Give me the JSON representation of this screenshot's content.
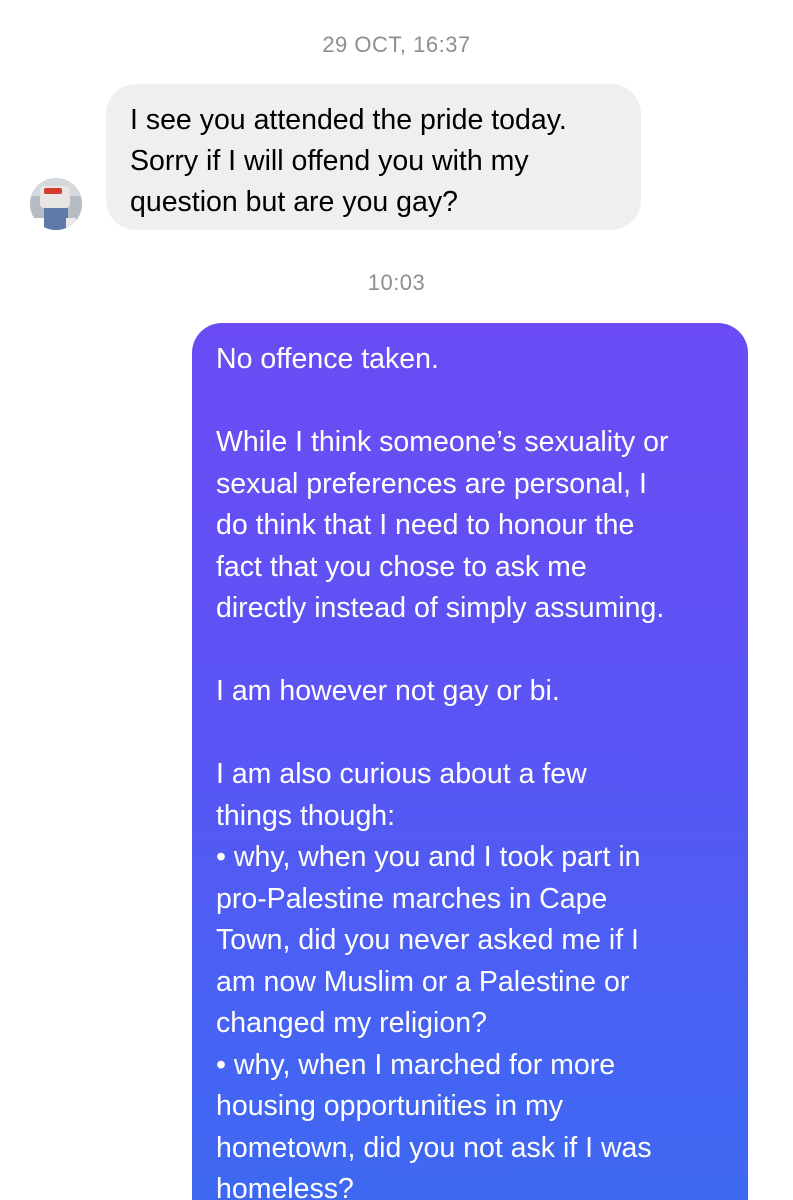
{
  "timestamps": {
    "first": "29 OCT, 16:37",
    "second": "10:03"
  },
  "received_message": {
    "sender_avatar": "contact-avatar",
    "lines": [
      "I see you attended the pride today.",
      "Sorry if I will offend you with my",
      "question but are you gay?"
    ]
  },
  "sent_message": {
    "colors": {
      "gradient_top": "#6b4cf4",
      "gradient_bottom": "#3c6af2",
      "text": "#ffffff"
    },
    "lines": [
      "No offence taken.",
      "",
      "While I think someone’s sexuality or",
      "sexual preferences are personal, I",
      "do think that I need to honour the",
      "fact that you chose to ask me",
      "directly instead of simply assuming.",
      "",
      "I am however not gay or bi.",
      "",
      "I am also curious about a few",
      "things though:",
      "• why, when you and I took part in",
      "pro-Palestine marches in Cape",
      "Town, did you never asked me if I",
      "am now Muslim or a Palestine or",
      "changed my religion?",
      "• why, when I marched for more",
      "housing opportunities in my",
      "hometown, did you not ask if I was",
      "homeless?"
    ]
  }
}
